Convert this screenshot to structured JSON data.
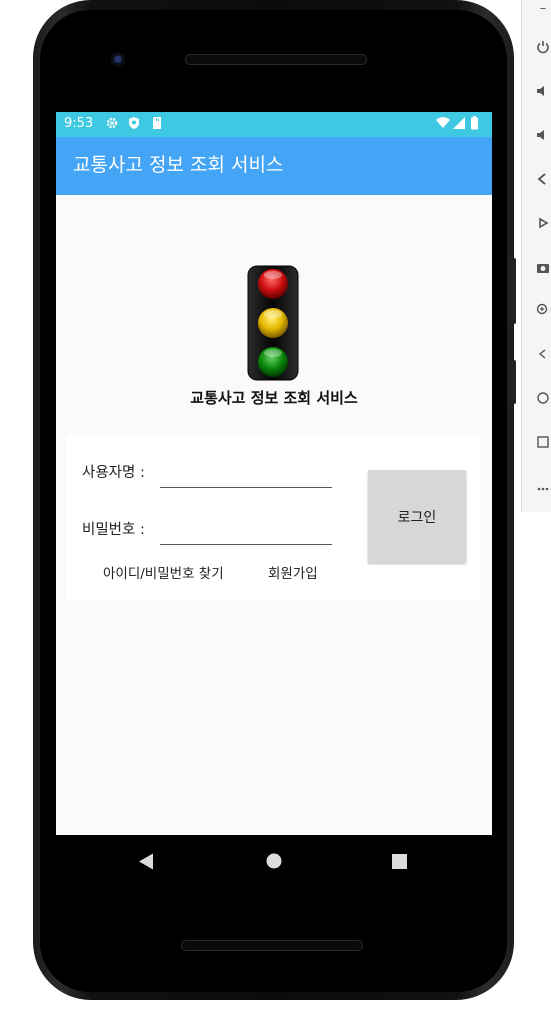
{
  "status_bar": {
    "time": "9:53",
    "icons": [
      "gear-icon",
      "shield-icon",
      "sd-card-icon",
      "wifi-icon",
      "signal-icon",
      "battery-icon"
    ],
    "background": "#3fc8e1"
  },
  "app_bar": {
    "title": "교통사고 정보 조회 서비스",
    "background": "#44a4f5"
  },
  "logo": {
    "icon": "traffic-light-icon",
    "caption": "교통사고 정보 조회 서비스"
  },
  "login_form": {
    "username_label": "사용자명 :",
    "username_value": "",
    "password_label": "비밀번호 :",
    "password_value": "",
    "login_button": "로그인",
    "find_account_link": "아이디/비밀번호 찾기",
    "signup_link": "회원가입"
  },
  "nav_bar": {
    "buttons": [
      "back-icon",
      "home-icon",
      "recents-icon"
    ]
  },
  "emulator_toolbar": {
    "minimize": "–",
    "buttons": [
      "power-icon",
      "volume-up-icon",
      "volume-down-icon",
      "rotate-left-icon",
      "rotate-right-icon",
      "camera-icon",
      "zoom-icon",
      "back-icon",
      "home-icon",
      "overview-icon",
      "more-icon"
    ]
  }
}
